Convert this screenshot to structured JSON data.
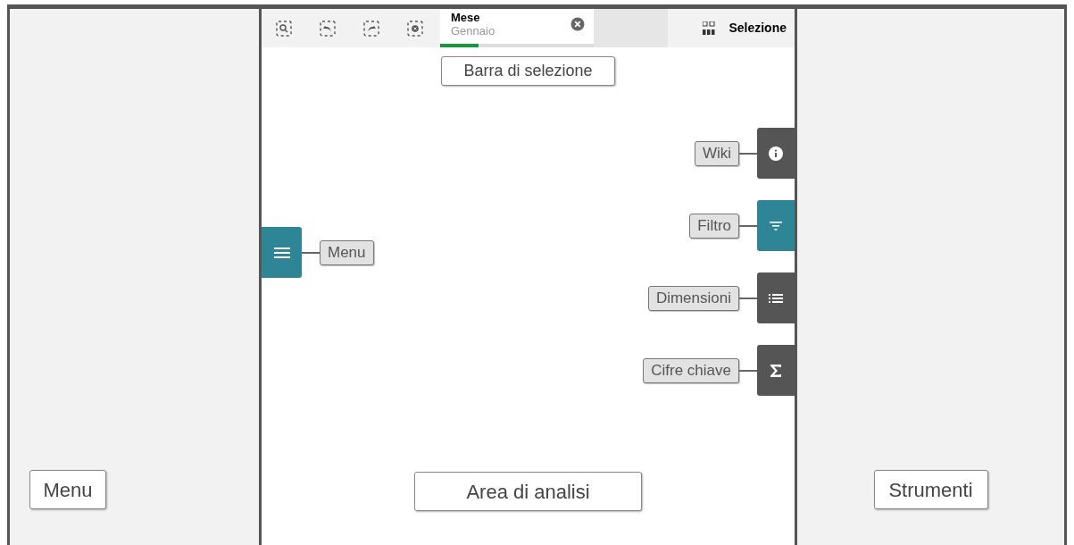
{
  "left_panel": {
    "label": "Menu"
  },
  "toolbar": {
    "selection_chip": {
      "field": "Mese",
      "value": "Gennaio",
      "level": 0.25
    },
    "selection_button": "Selezione"
  },
  "selection_bar_label": "Barra di selezione",
  "menu_button": {
    "selected": true,
    "label": "Menu"
  },
  "side_tabs": [
    {
      "kind": "info",
      "label": "Wiki",
      "selected": false
    },
    {
      "kind": "filter",
      "label": "Filtro",
      "selected": true
    },
    {
      "kind": "list",
      "label": "Dimensioni",
      "selected": false
    },
    {
      "kind": "sigma",
      "label": "Cifre chiave",
      "selected": false
    }
  ],
  "analysis_area_label": "Area di analisi",
  "right_panel": {
    "label": "Strumenti"
  }
}
